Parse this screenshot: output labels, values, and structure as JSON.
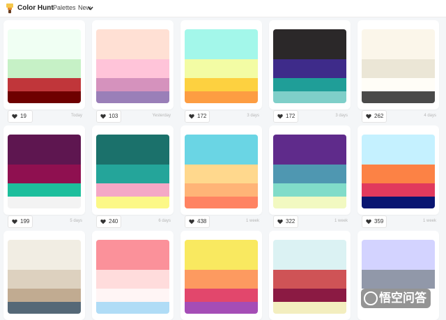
{
  "header": {
    "brand": "Color Hunt",
    "nav": {
      "palettes": "Palettes",
      "new": "New"
    },
    "logo_icon": "paint-brush-icon",
    "chevron_icon": "chevron-down-icon"
  },
  "cards": [
    {
      "likes": "19",
      "date": "Today",
      "colors": [
        "#f0fff3",
        "#c6f1c6",
        "#c0363a",
        "#6e0000"
      ]
    },
    {
      "likes": "103",
      "date": "Yesterday",
      "colors": [
        "#ffe0d4",
        "#ffc4d9",
        "#d592bd",
        "#9a7fb8"
      ]
    },
    {
      "likes": "172",
      "date": "3 days",
      "colors": [
        "#a3f7ea",
        "#f3fca4",
        "#fdd140",
        "#fd9d42"
      ]
    },
    {
      "likes": "172",
      "date": "3 days",
      "colors": [
        "#2b2829",
        "#3e2b8a",
        "#1f9e98",
        "#7fcfc9"
      ]
    },
    {
      "likes": "262",
      "date": "4 days",
      "colors": [
        "#fbf6ea",
        "#ebe6d6",
        "#fffdf7",
        "#4a4a4a"
      ]
    },
    {
      "likes": "199",
      "date": "5 days",
      "colors": [
        "#5e1650",
        "#8f1050",
        "#1dbe9c",
        "#f3f3f3"
      ]
    },
    {
      "likes": "240",
      "date": "6 days",
      "colors": [
        "#1b716b",
        "#24a59a",
        "#f4a8c6",
        "#fcf887"
      ]
    },
    {
      "likes": "438",
      "date": "1 week",
      "colors": [
        "#6ad5e4",
        "#ffd88d",
        "#ffb477",
        "#ff8362"
      ]
    },
    {
      "likes": "322",
      "date": "1 week",
      "colors": [
        "#5f2b8b",
        "#4f97b1",
        "#81dcc9",
        "#f2f9c1"
      ]
    },
    {
      "likes": "359",
      "date": "1 week",
      "colors": [
        "#c5f1ff",
        "#fc8245",
        "#e13a5d",
        "#091571"
      ]
    },
    {
      "likes": "",
      "date": "",
      "colors": [
        "#f1ede3",
        "#ddd1bf",
        "#c1ab91",
        "#556877"
      ]
    },
    {
      "likes": "",
      "date": "",
      "colors": [
        "#fb919a",
        "#ffdcdc",
        "#fff5f5",
        "#b0dcf6"
      ]
    },
    {
      "likes": "",
      "date": "",
      "colors": [
        "#f9e960",
        "#fd9a60",
        "#e2476c",
        "#a54db6"
      ]
    },
    {
      "likes": "",
      "date": "",
      "colors": [
        "#dbf2f3",
        "#cf5356",
        "#8b1a43",
        "#f3eebf"
      ]
    },
    {
      "likes": "",
      "date": "",
      "colors": [
        "#d3d3ff",
        "#9198a9",
        "#ffffff",
        "#ffffff"
      ]
    }
  ],
  "icons": {
    "like": "heart-icon"
  },
  "watermark": {
    "text": "悟空问答",
    "icon": "circle-icon"
  }
}
